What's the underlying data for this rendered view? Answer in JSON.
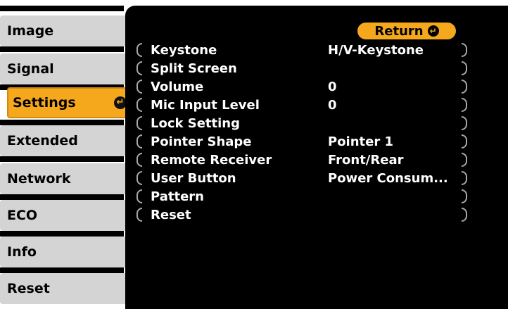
{
  "sidebar": {
    "items": [
      {
        "label": "Image"
      },
      {
        "label": "Signal"
      },
      {
        "label": "Settings",
        "selected": true
      },
      {
        "label": "Extended"
      },
      {
        "label": "Network"
      },
      {
        "label": "ECO"
      },
      {
        "label": "Info"
      },
      {
        "label": "Reset"
      }
    ]
  },
  "main": {
    "return_label": "Return",
    "items": [
      {
        "label": "Keystone",
        "value": "H/V-Keystone"
      },
      {
        "label": "Split Screen",
        "value": ""
      },
      {
        "label": "Volume",
        "value": "0"
      },
      {
        "label": "Mic Input Level",
        "value": "0"
      },
      {
        "label": "Lock Setting",
        "value": ""
      },
      {
        "label": "Pointer Shape",
        "value": "Pointer 1"
      },
      {
        "label": "Remote Receiver",
        "value": "Front/Rear"
      },
      {
        "label": "User Button",
        "value": "Power Consum..."
      },
      {
        "label": "Pattern",
        "value": ""
      },
      {
        "label": "Reset",
        "value": ""
      }
    ]
  },
  "colors": {
    "accent": "#f6a81c",
    "tab_bg": "#d4d4d4",
    "panel_bg": "#000000"
  },
  "icons": {
    "enter": "enter-icon"
  }
}
